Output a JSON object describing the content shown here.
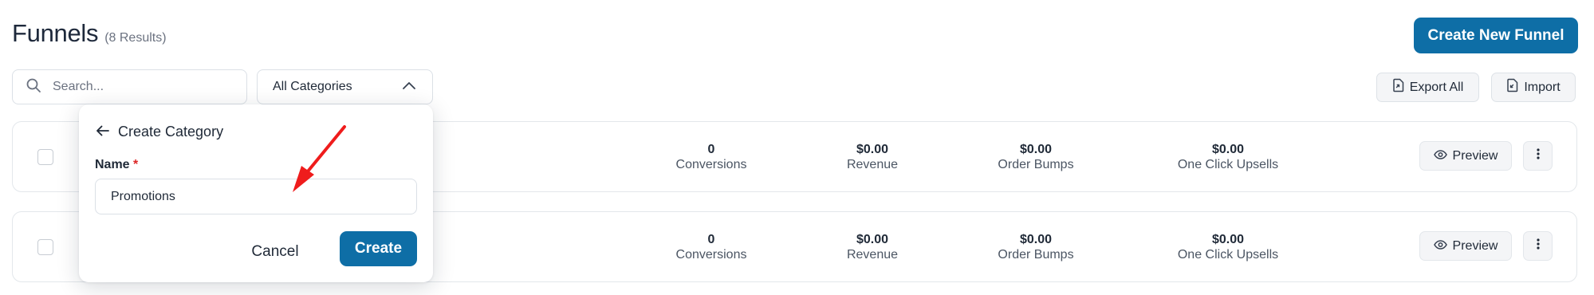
{
  "header": {
    "title": "Funnels",
    "count": "(8 Results)",
    "create_button": "Create New Funnel"
  },
  "toolbar": {
    "search_placeholder": "Search...",
    "category_select": "All Categories",
    "export_label": "Export All",
    "import_label": "Import"
  },
  "rows": [
    {
      "stats": [
        {
          "value": "0",
          "label": "Conversions"
        },
        {
          "value": "$0.00",
          "label": "Revenue"
        },
        {
          "value": "$0.00",
          "label": "Order Bumps"
        },
        {
          "value": "$0.00",
          "label": "One Click Upsells"
        }
      ],
      "preview_label": "Preview"
    },
    {
      "stats": [
        {
          "value": "0",
          "label": "Conversions"
        },
        {
          "value": "$0.00",
          "label": "Revenue"
        },
        {
          "value": "$0.00",
          "label": "Order Bumps"
        },
        {
          "value": "$0.00",
          "label": "One Click Upsells"
        }
      ],
      "preview_label": "Preview"
    }
  ],
  "create_category": {
    "title": "Create Category",
    "name_label": "Name",
    "required_mark": "*",
    "name_value": "Promotions",
    "cancel_label": "Cancel",
    "create_label": "Create"
  },
  "colors": {
    "primary": "#0e6ea6",
    "annotation_arrow": "#ef1c1c",
    "required": "#dc2626"
  },
  "icons": [
    "search-icon",
    "chevron-up-icon",
    "export-file-icon",
    "import-file-icon",
    "eye-icon",
    "more-vertical-icon",
    "arrow-left-icon"
  ]
}
